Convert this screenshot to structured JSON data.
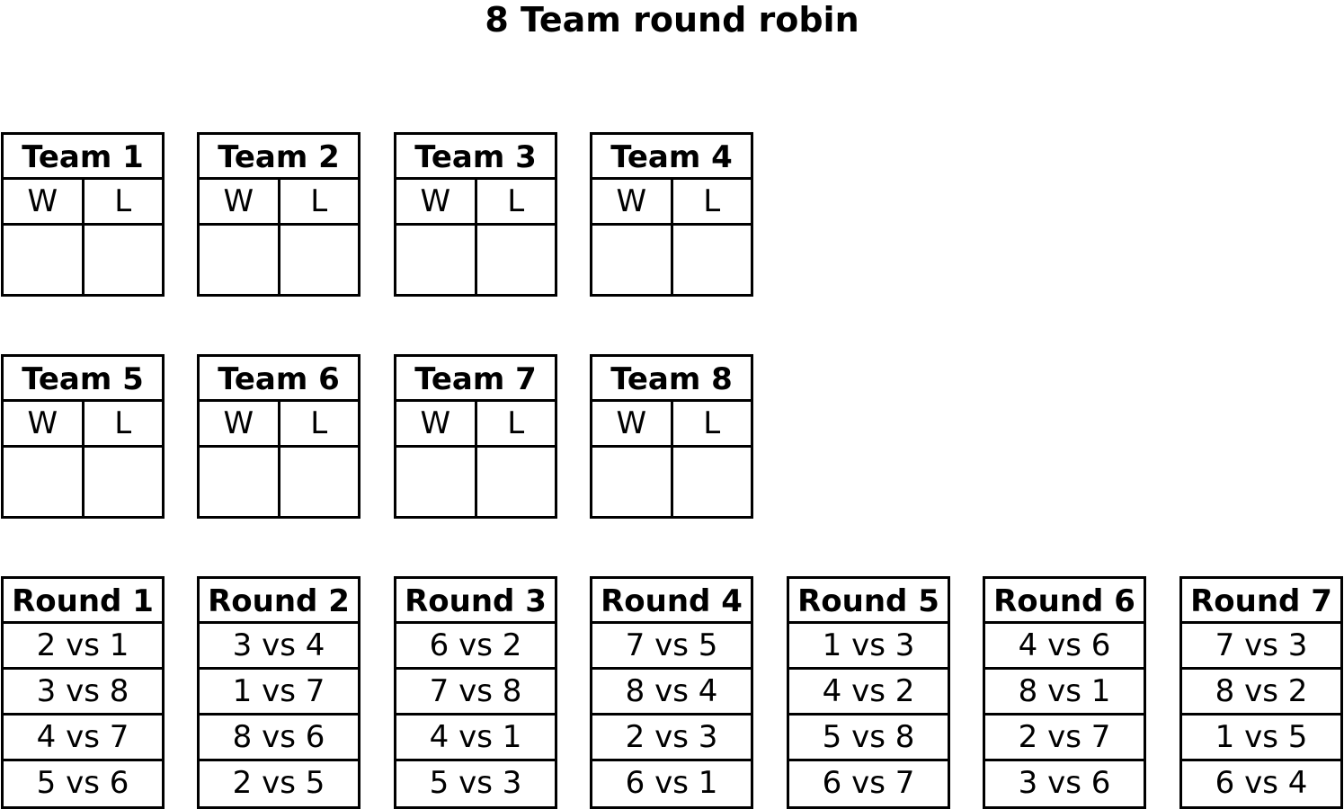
{
  "title": "8 Team round robin",
  "record_labels": {
    "win": "W",
    "loss": "L"
  },
  "teams": [
    {
      "name": "Team 1",
      "wins": "",
      "losses": ""
    },
    {
      "name": "Team 2",
      "wins": "",
      "losses": ""
    },
    {
      "name": "Team 3",
      "wins": "",
      "losses": ""
    },
    {
      "name": "Team 4",
      "wins": "",
      "losses": ""
    },
    {
      "name": "Team 5",
      "wins": "",
      "losses": ""
    },
    {
      "name": "Team 6",
      "wins": "",
      "losses": ""
    },
    {
      "name": "Team 7",
      "wins": "",
      "losses": ""
    },
    {
      "name": "Team 8",
      "wins": "",
      "losses": ""
    }
  ],
  "rounds": [
    {
      "name": "Round 1",
      "matches": [
        "2 vs 1",
        "3 vs 8",
        "4 vs 7",
        "5 vs 6"
      ]
    },
    {
      "name": "Round 2",
      "matches": [
        "3 vs 4",
        "1 vs 7",
        "8 vs 6",
        "2 vs 5"
      ]
    },
    {
      "name": "Round 3",
      "matches": [
        "6 vs 2",
        "7 vs 8",
        "4 vs 1",
        "5 vs 3"
      ]
    },
    {
      "name": "Round 4",
      "matches": [
        "7 vs 5",
        "8 vs 4",
        "2 vs 3",
        "6 vs 1"
      ]
    },
    {
      "name": "Round 5",
      "matches": [
        "1 vs 3",
        "4 vs 2",
        "5 vs 8",
        "6 vs 7"
      ]
    },
    {
      "name": "Round 6",
      "matches": [
        "4 vs 6",
        "8 vs 1",
        "2 vs 7",
        "3 vs 6"
      ]
    },
    {
      "name": "Round 7",
      "matches": [
        "7 vs 3",
        "8 vs 2",
        "1 vs 5",
        "6 vs 4"
      ]
    }
  ]
}
